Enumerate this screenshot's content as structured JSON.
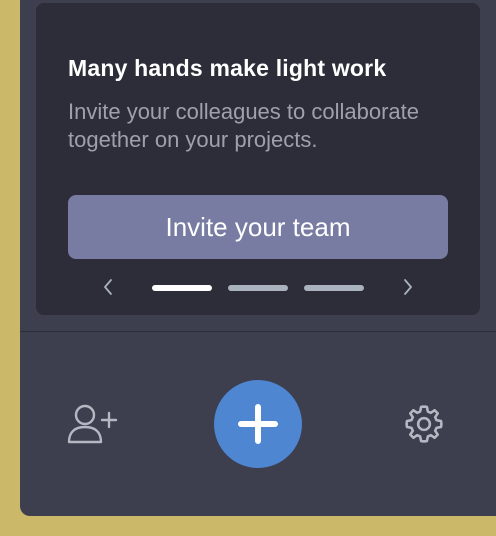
{
  "card": {
    "title": "Many hands make light work",
    "description": "Invite your colleagues to collaborate together on your projects.",
    "invite_button_label": "Invite your team",
    "carousel": {
      "pages": 3,
      "active_index": 0,
      "prev_icon": "chevron-left-icon",
      "next_icon": "chevron-right-icon"
    }
  },
  "footer": {
    "add_user_icon": "add-user-icon",
    "create_icon": "plus-icon",
    "settings_icon": "gear-icon"
  },
  "colors": {
    "accent": "#4e86d2",
    "button": "#787ba2",
    "panel": "#3d3e4e",
    "card": "#2c2d38",
    "frame": "#cbb868"
  }
}
